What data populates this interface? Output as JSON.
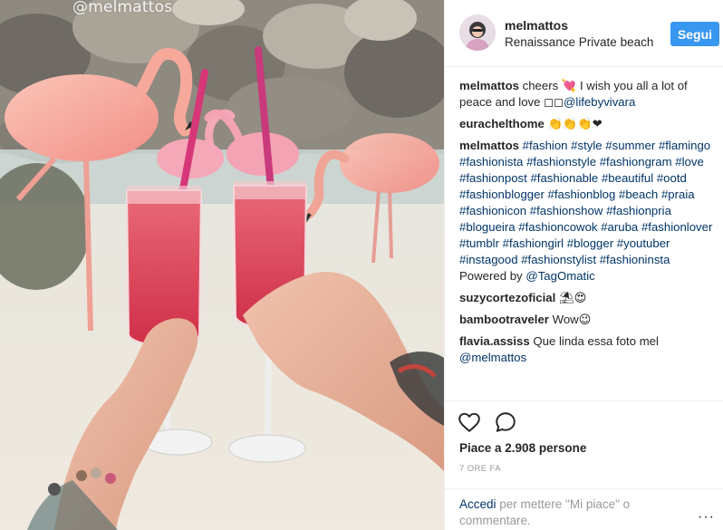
{
  "photo": {
    "watermark": "@melmattos"
  },
  "header": {
    "username": "melmattos",
    "location": "Renaissance Private beach",
    "follow_label": "Segui"
  },
  "comments": [
    {
      "author": "melmattos",
      "parts": [
        {
          "text": " cheers 💘 I wish you all a lot of peace and love ◻◻"
        },
        {
          "text": "@lifebyvivara",
          "tag": true
        }
      ]
    },
    {
      "author": "eurachelthome",
      "parts": [
        {
          "text": " 👏👏👏❤"
        }
      ]
    },
    {
      "author": "melmattos",
      "parts": [
        {
          "text": " "
        },
        {
          "text": "#fashion",
          "tag": true
        },
        {
          "text": " "
        },
        {
          "text": "#style",
          "tag": true
        },
        {
          "text": " "
        },
        {
          "text": "#summer",
          "tag": true
        },
        {
          "text": " "
        },
        {
          "text": "#flamingo",
          "tag": true
        },
        {
          "text": " "
        },
        {
          "text": "#fashionista",
          "tag": true
        },
        {
          "text": " "
        },
        {
          "text": "#fashionstyle",
          "tag": true
        },
        {
          "text": " "
        },
        {
          "text": "#fashiongram",
          "tag": true
        },
        {
          "text": " "
        },
        {
          "text": "#love",
          "tag": true
        },
        {
          "text": " "
        },
        {
          "text": "#fashionpost",
          "tag": true
        },
        {
          "text": " "
        },
        {
          "text": "#fashionable",
          "tag": true
        },
        {
          "text": " "
        },
        {
          "text": "#beautiful",
          "tag": true
        },
        {
          "text": " "
        },
        {
          "text": "#ootd",
          "tag": true
        },
        {
          "text": " "
        },
        {
          "text": "#fashionblogger",
          "tag": true
        },
        {
          "text": " "
        },
        {
          "text": "#fashionblog",
          "tag": true
        },
        {
          "text": " "
        },
        {
          "text": "#beach",
          "tag": true
        },
        {
          "text": " "
        },
        {
          "text": "#praia",
          "tag": true
        },
        {
          "text": " "
        },
        {
          "text": "#fashionicon",
          "tag": true
        },
        {
          "text": " "
        },
        {
          "text": "#fashionshow",
          "tag": true
        },
        {
          "text": " "
        },
        {
          "text": "#fashionpria",
          "tag": true
        },
        {
          "text": " "
        },
        {
          "text": "#blogueira",
          "tag": true
        },
        {
          "text": " "
        },
        {
          "text": "#fashioncowok",
          "tag": true
        },
        {
          "text": " "
        },
        {
          "text": "#aruba",
          "tag": true
        },
        {
          "text": " "
        },
        {
          "text": "#fashionlover",
          "tag": true
        },
        {
          "text": " "
        },
        {
          "text": "#tumblr",
          "tag": true
        },
        {
          "text": " "
        },
        {
          "text": "#fashiongirl",
          "tag": true
        },
        {
          "text": " "
        },
        {
          "text": "#blogger",
          "tag": true
        },
        {
          "text": " "
        },
        {
          "text": "#youtuber",
          "tag": true
        },
        {
          "text": " "
        },
        {
          "text": "#instagood",
          "tag": true
        },
        {
          "text": " "
        },
        {
          "text": "#fashionstylist",
          "tag": true
        },
        {
          "text": " "
        },
        {
          "text": "#fashioninsta",
          "tag": true
        },
        {
          "text": " Powered by "
        },
        {
          "text": "@TagOmatic",
          "tag": true
        }
      ]
    },
    {
      "author": "suzycortezoficial",
      "parts": [
        {
          "text": " ⛱😍"
        }
      ]
    },
    {
      "author": "bambootraveler",
      "parts": [
        {
          "text": " Wow😉"
        }
      ]
    },
    {
      "author": "flavia.assiss",
      "parts": [
        {
          "text": " Que linda essa foto mel "
        },
        {
          "text": "@melmattos",
          "tag": true
        }
      ]
    }
  ],
  "actions": {
    "like_icon": "heart-icon",
    "comment_icon": "comment-bubble-icon",
    "likes_text": "Piace a 2.908 persone",
    "time_text": "7 ORE FA"
  },
  "add_comment": {
    "login_link": "Accedi",
    "rest_text": " per mettere \"Mi piace\" o commentare.",
    "more_icon": "more-options-icon",
    "more_text": "···"
  },
  "colors": {
    "follow_button": "#3897f0",
    "tag_link": "#003569",
    "muted_text": "#999999"
  }
}
